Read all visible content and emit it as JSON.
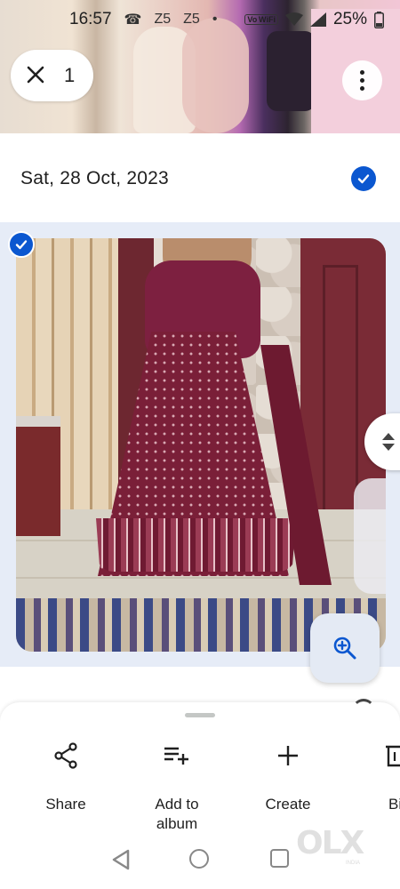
{
  "status_bar": {
    "time": "16:57",
    "indicator_1": "Z5",
    "indicator_2": "Z5",
    "dot": "•",
    "wifi_label": "Vo WiFi",
    "battery": "25%"
  },
  "selection": {
    "close_icon": "close-icon",
    "count": "1"
  },
  "section": {
    "date": "Sat, 28 Oct, 2023"
  },
  "actions": [
    {
      "label": "Share",
      "icon": "share-icon"
    },
    {
      "label": "Add to\nalbum",
      "icon": "playlist-add-icon"
    },
    {
      "label": "Create",
      "icon": "plus-icon"
    },
    {
      "label": "Bi",
      "icon": "trash-icon"
    }
  ],
  "watermark": {
    "text": "OLX",
    "sub": "INDIA"
  },
  "colors": {
    "accent": "#0b57d0",
    "selected_bg": "#e6ecf7",
    "zoom_btn_bg": "#e4eaf4"
  }
}
